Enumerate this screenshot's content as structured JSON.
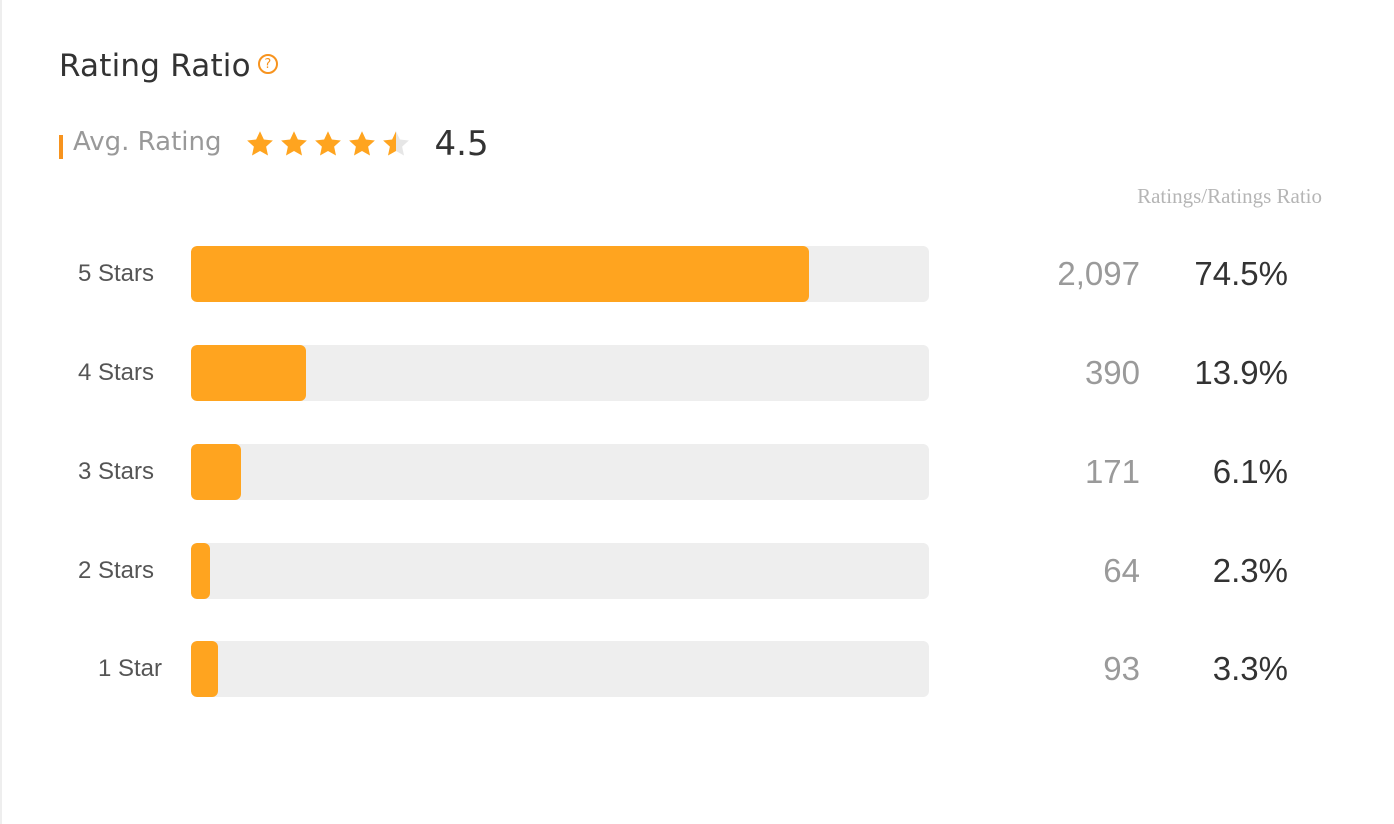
{
  "header": {
    "title": "Rating Ratio",
    "help_icon": "question-circle-icon"
  },
  "avg": {
    "label": "Avg. Rating",
    "value": "4.5",
    "stars": 4.5,
    "max_stars": 5
  },
  "columns": {
    "header": "Ratings/Ratings Ratio"
  },
  "colors": {
    "accent": "#f7931e",
    "bar_fill": "#ffa41f",
    "track": "#eeeeee",
    "star_empty": "#e6e6e6"
  },
  "rows": [
    {
      "label": "5 Stars",
      "count": "2,097",
      "ratio": "74.5%",
      "fill_fraction": 0.838
    },
    {
      "label": "4 Stars",
      "count": "390",
      "ratio": "13.9%",
      "fill_fraction": 0.156
    },
    {
      "label": "3 Stars",
      "count": "171",
      "ratio": "6.1%",
      "fill_fraction": 0.068
    },
    {
      "label": "2 Stars",
      "count": "64",
      "ratio": "2.3%",
      "fill_fraction": 0.026
    },
    {
      "label": "1 Star",
      "count": "93",
      "ratio": "3.3%",
      "fill_fraction": 0.037
    }
  ]
}
